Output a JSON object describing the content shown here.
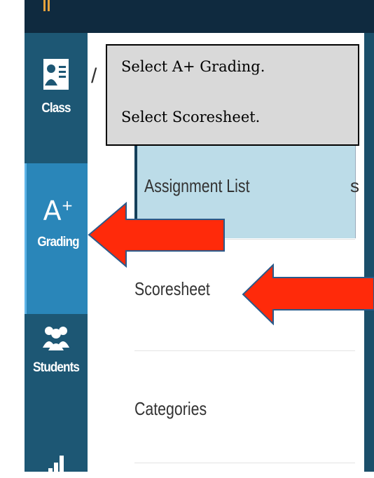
{
  "sidebar": {
    "items": [
      {
        "label": "Class",
        "icon": "class-icon"
      },
      {
        "label": "Grading",
        "icon": "grade-a-plus-icon",
        "glyph": "A"
      },
      {
        "label": "Students",
        "icon": "students-icon"
      },
      {
        "label": "",
        "icon": "chart-icon"
      }
    ]
  },
  "menu": {
    "items": [
      {
        "label": "Assignment List",
        "selected": true
      },
      {
        "label": "Scoresheet"
      },
      {
        "label": "Categories"
      }
    ]
  },
  "callout": {
    "line1": "Select A+ Grading.",
    "line2": "Select Scoresheet."
  },
  "colors": {
    "topbar": "#0f2a3f",
    "sidebar": "#1d5774",
    "sidebar_active": "#2a86b9",
    "menu_selected": "#bcdce8",
    "arrow": "#ff2a0a"
  }
}
